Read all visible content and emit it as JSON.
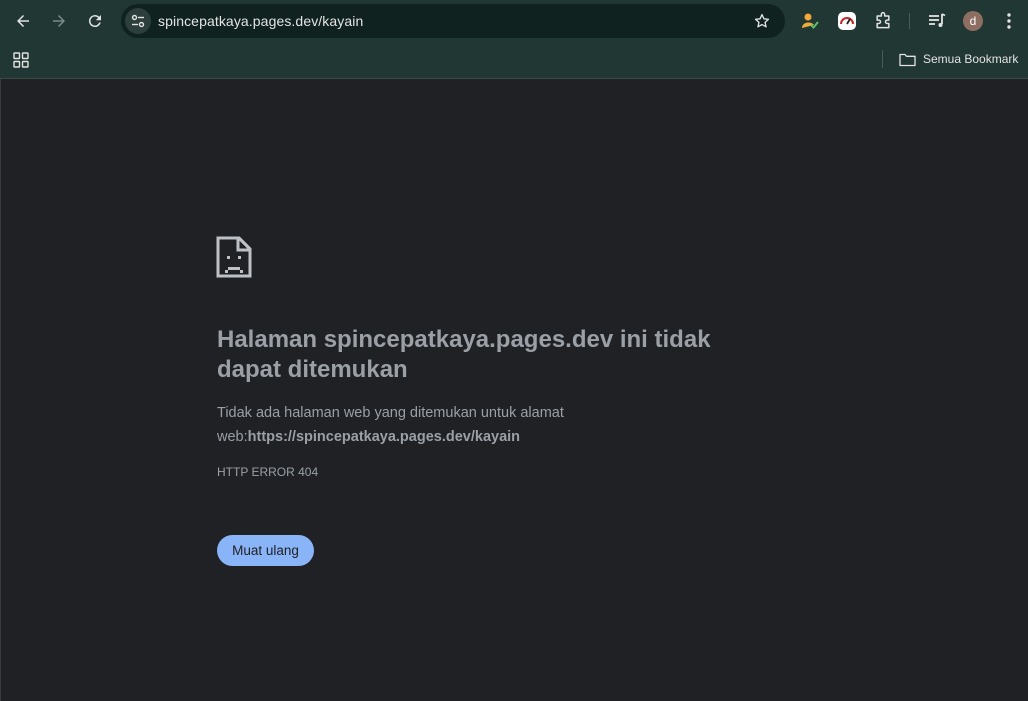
{
  "browser": {
    "url": "spincepatkaya.pages.dev/kayain",
    "bookmarks_folder_label": "Semua Bookmark",
    "profile_initial": "d"
  },
  "error_page": {
    "title": "Halaman spincepatkaya.pages.dev ini tidak dapat ditemukan",
    "description_prefix": "Tidak ada halaman web yang ditemukan untuk alamat web:",
    "description_url": "https://spincepatkaya.pages.dev/kayain",
    "error_code": "HTTP ERROR 404",
    "reload_label": "Muat ulang"
  },
  "colors": {
    "toolbar_bg": "#213733",
    "omnibox_bg": "#0f2220",
    "page_bg": "#202124",
    "text_muted": "#9aa0a6",
    "button_accent": "#8ab4f8"
  },
  "icons": [
    "back-icon",
    "forward-icon",
    "reload-icon",
    "site-info-icon",
    "bookmark-star-icon",
    "profile-sync-icon",
    "performance-icon",
    "extensions-icon",
    "media-queue-icon",
    "menu-icon",
    "apps-grid-icon",
    "folder-icon",
    "sad-page-icon"
  ]
}
